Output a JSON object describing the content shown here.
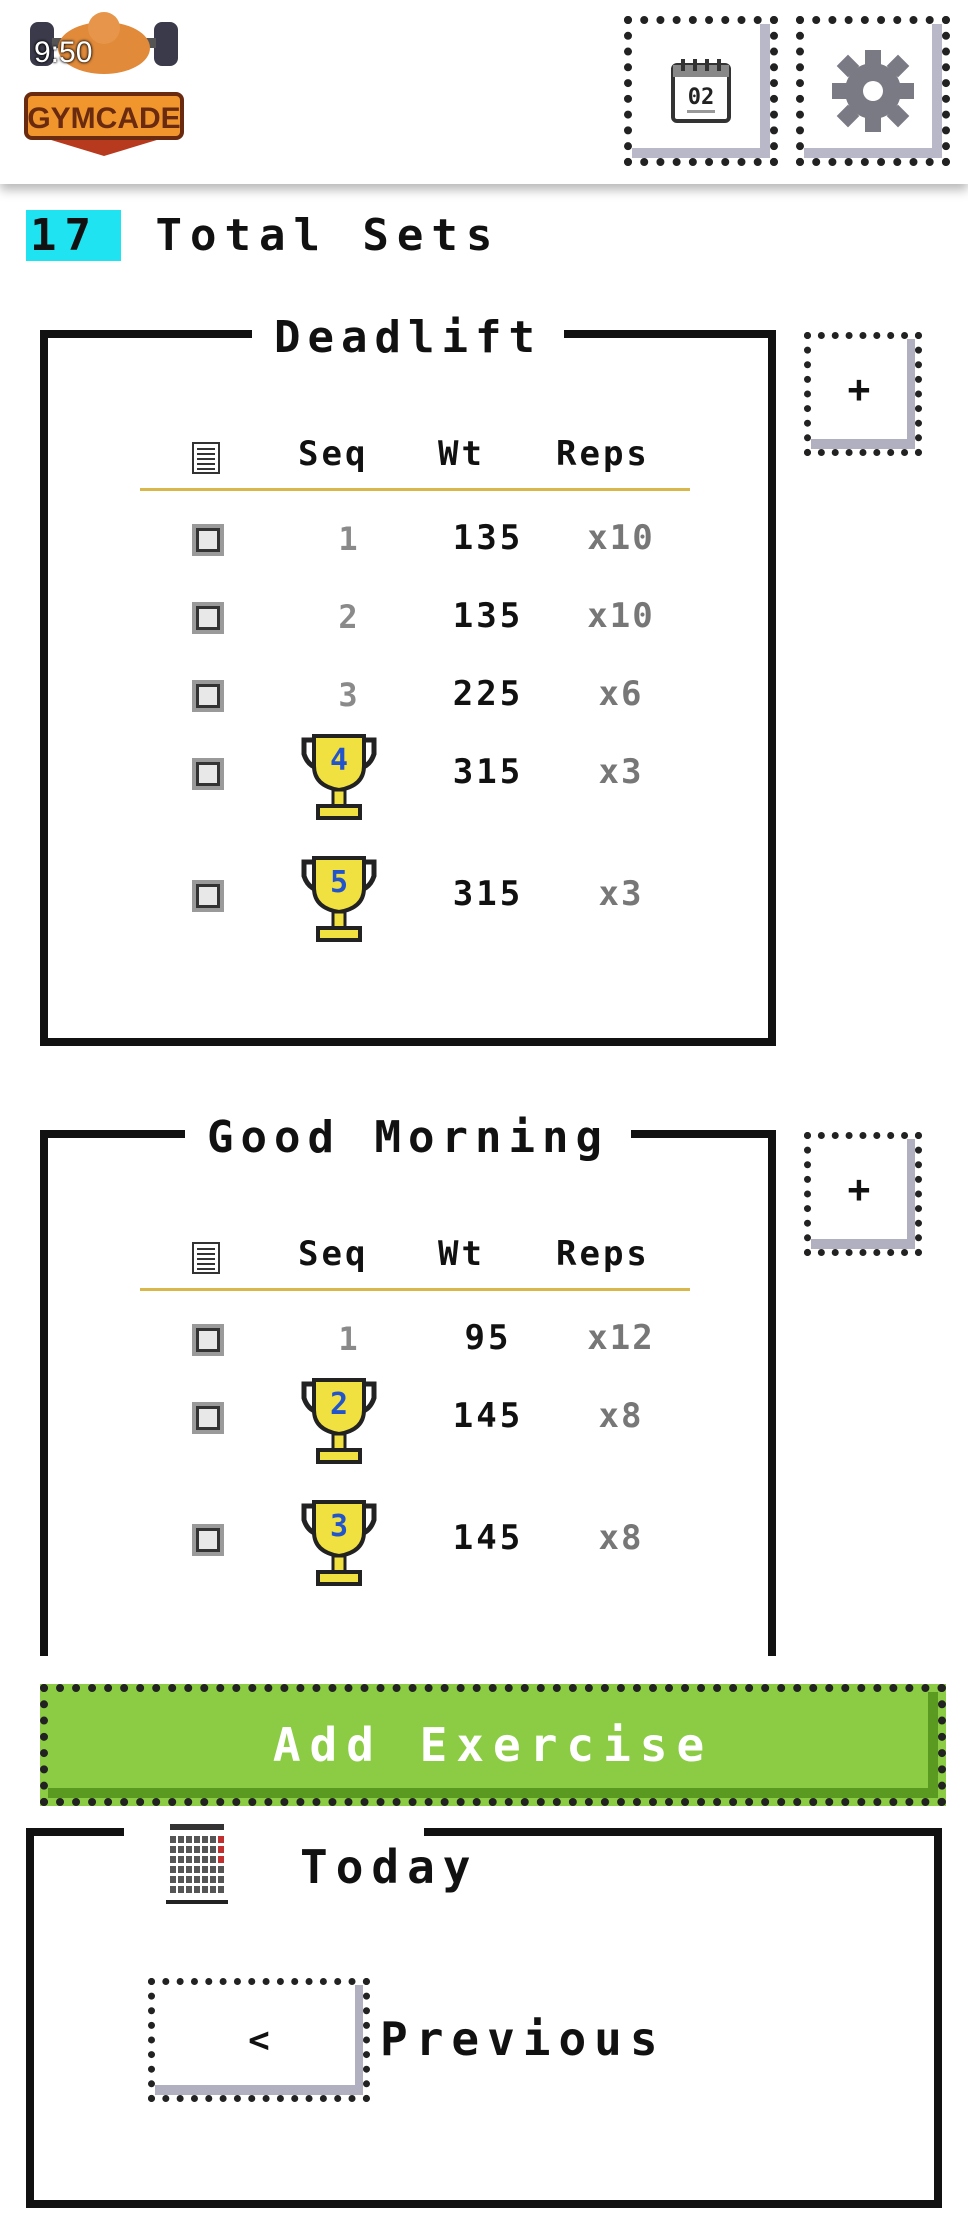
{
  "status": {
    "time": "9:50"
  },
  "header": {
    "app_name": "GYMCADE",
    "calendar_day": "02"
  },
  "summary": {
    "count": "17",
    "label": "Total Sets"
  },
  "columns": {
    "seq": "Seq",
    "wt": "Wt",
    "reps": "Reps"
  },
  "exercises": [
    {
      "name": "Deadlift",
      "add_label": "+",
      "sets": [
        {
          "seq": "1",
          "wt": "135",
          "reps": "x10",
          "trophy": false
        },
        {
          "seq": "2",
          "wt": "135",
          "reps": "x10",
          "trophy": false
        },
        {
          "seq": "3",
          "wt": "225",
          "reps": "x6",
          "trophy": false
        },
        {
          "seq": "4",
          "wt": "315",
          "reps": "x3",
          "trophy": true
        },
        {
          "seq": "5",
          "wt": "315",
          "reps": "x3",
          "trophy": true
        }
      ]
    },
    {
      "name": "Good Morning",
      "add_label": "+",
      "sets": [
        {
          "seq": "1",
          "wt": "95",
          "reps": "x12",
          "trophy": false
        },
        {
          "seq": "2",
          "wt": "145",
          "reps": "x8",
          "trophy": true
        },
        {
          "seq": "3",
          "wt": "145",
          "reps": "x8",
          "trophy": true
        }
      ]
    }
  ],
  "add_exercise": {
    "label": "Add Exercise"
  },
  "day_nav": {
    "day_label": "Today",
    "prev_glyph": "<",
    "prev_label": "Previous"
  },
  "colors": {
    "accent": "#1fe3f0",
    "add_exercise": "#8ccc44",
    "trophy": "#f0e040",
    "divider": "#d8b84a"
  }
}
